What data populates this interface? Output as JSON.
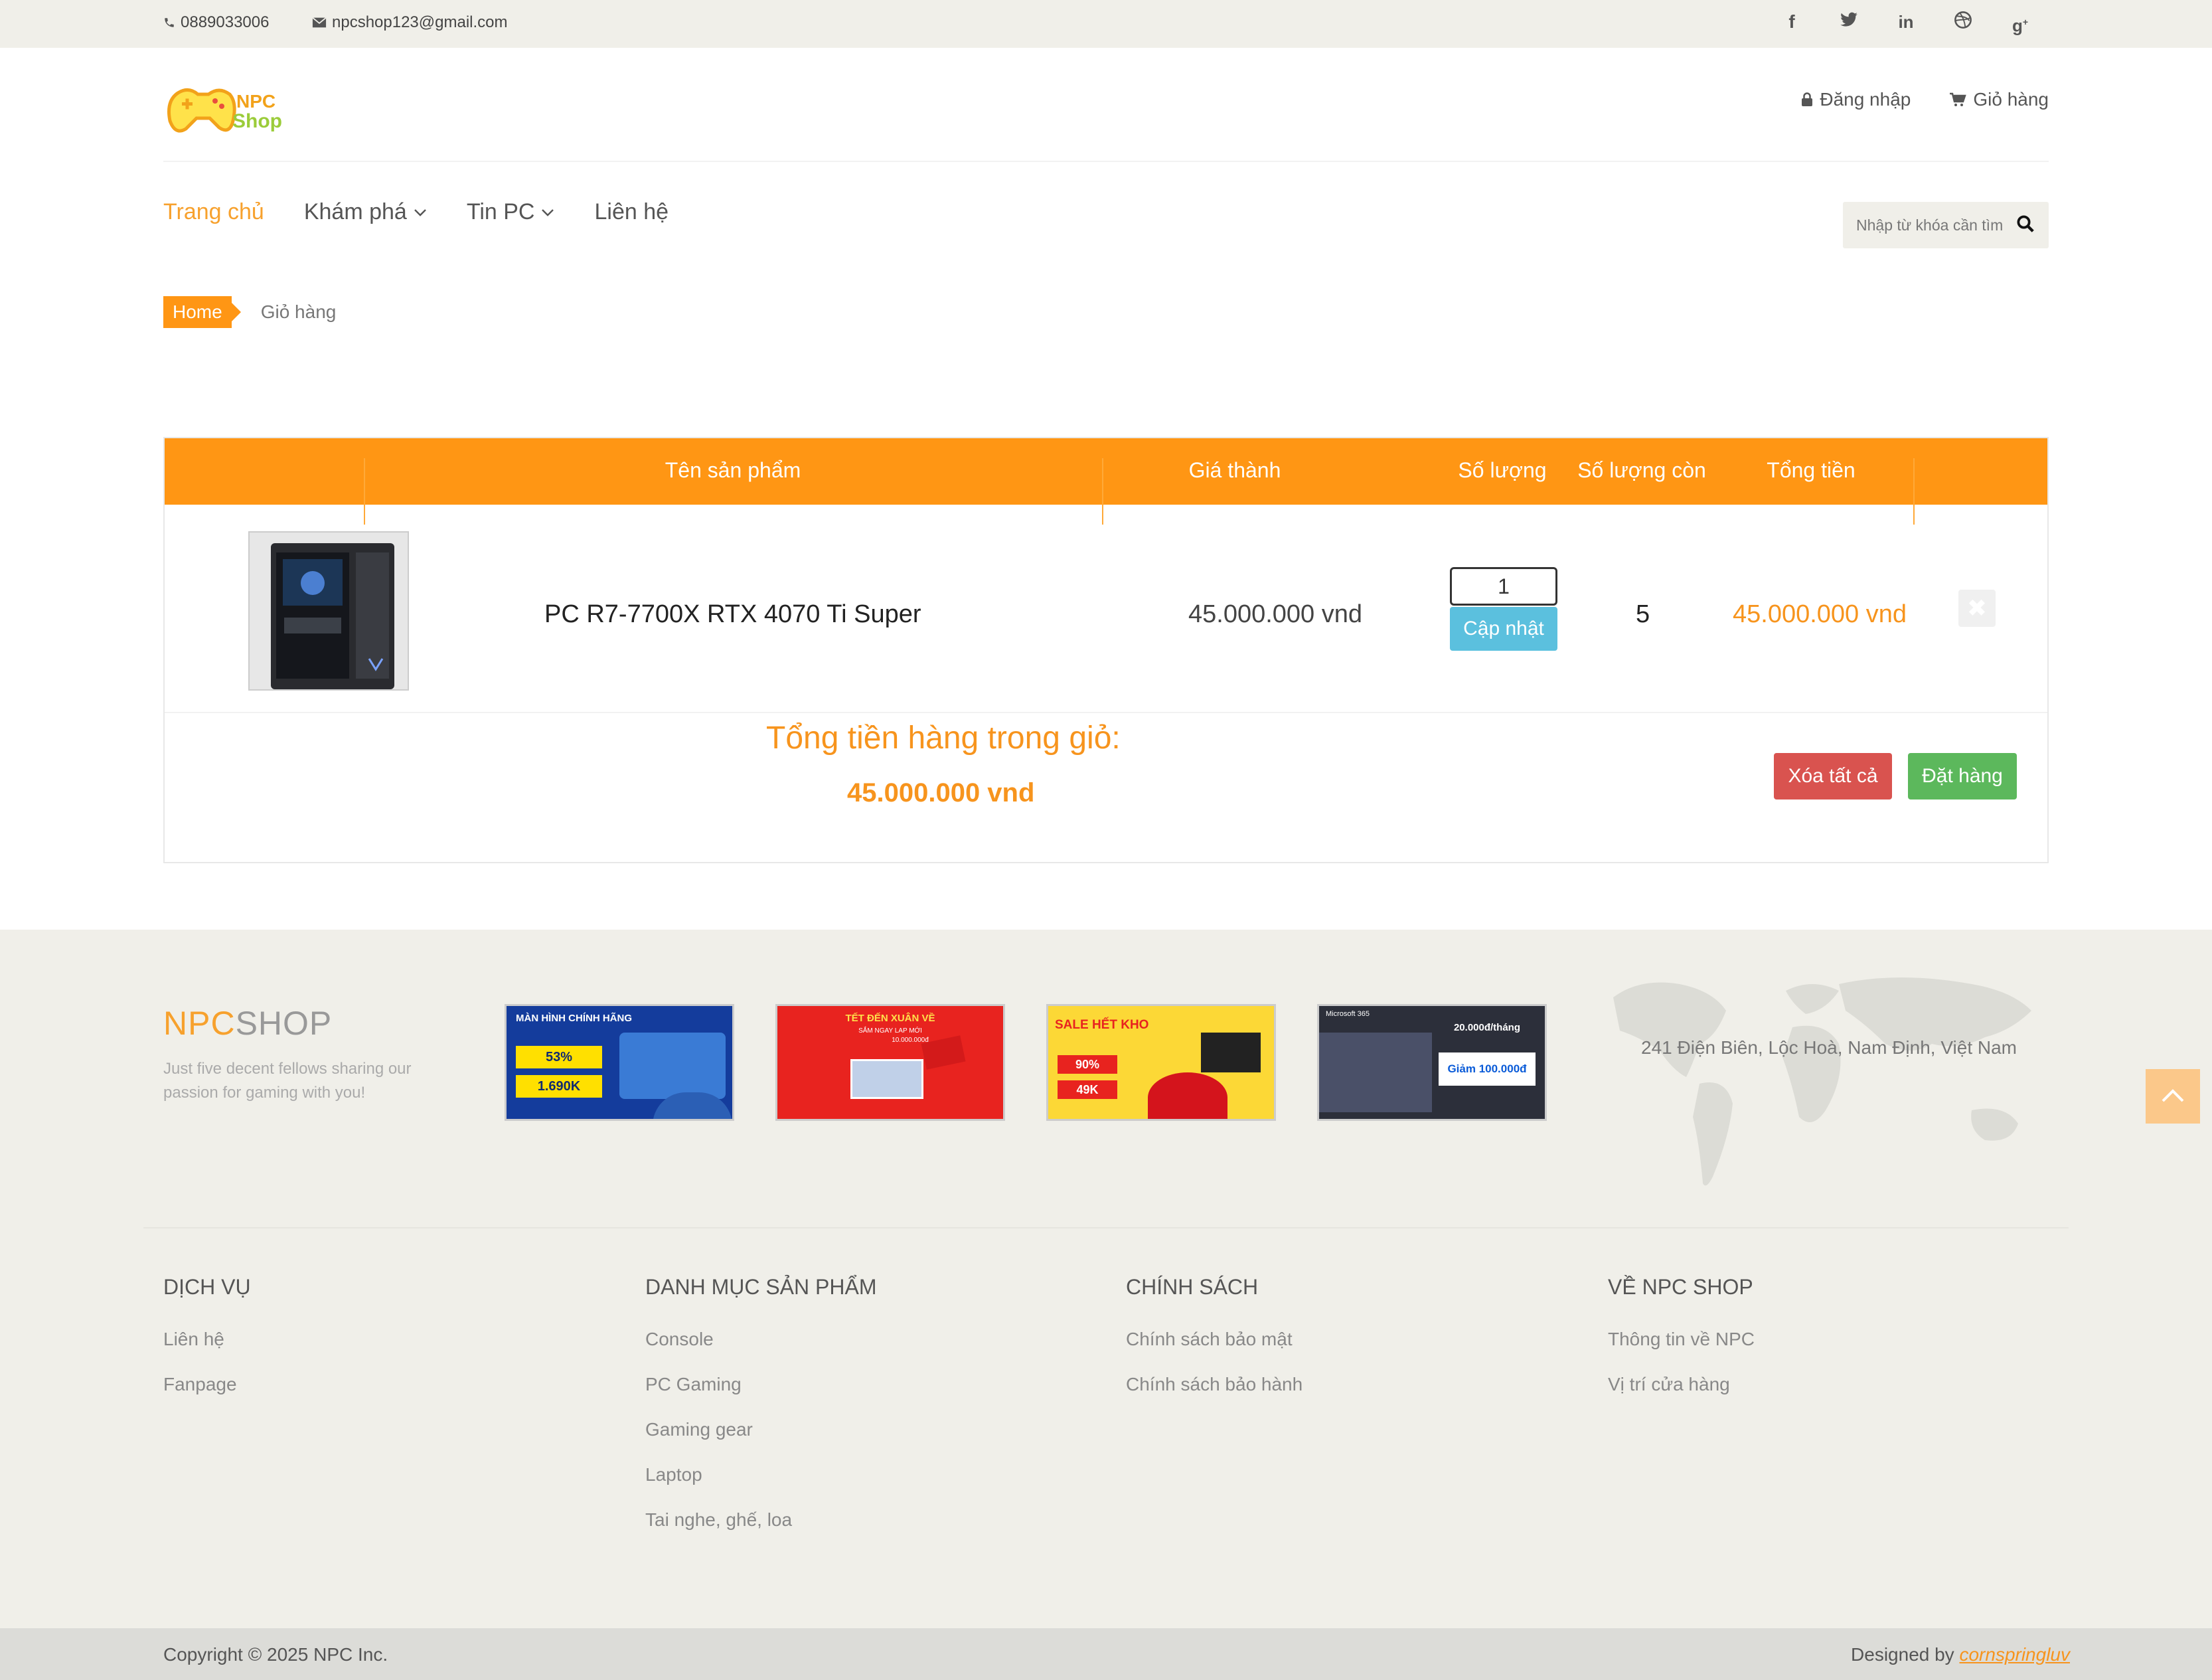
{
  "topbar": {
    "phone": "0889033006",
    "email": "npcshop123@gmail.com"
  },
  "social": [
    "facebook-icon",
    "twitter-icon",
    "linkedin-icon",
    "dribbble-icon",
    "google-plus-icon"
  ],
  "logo": {
    "line1": "NPC",
    "line2": "Shop"
  },
  "header": {
    "login": "Đăng nhập",
    "cart": "Giỏ hàng"
  },
  "nav": {
    "home": "Trang chủ",
    "explore": "Khám phá",
    "news": "Tin PC",
    "contact": "Liên hệ"
  },
  "search": {
    "placeholder": "Nhập từ khóa cần tìm"
  },
  "breadcrumb": {
    "home": "Home",
    "current": "Giỏ hàng"
  },
  "cart": {
    "columns": {
      "name": "Tên sản phẩm",
      "price": "Giá thành",
      "qty": "Số lượng",
      "stock": "Số lượng còn",
      "total": "Tổng tiền"
    },
    "items": [
      {
        "name": "PC R7-7700X RTX 4070 Ti Super",
        "price": "45.000.000 vnd",
        "qty": "1",
        "stock": "5",
        "total": "45.000.000 vnd"
      }
    ],
    "update_label": "Cập nhật",
    "total_label": "Tổng tiền hàng trong giỏ:",
    "total_value": "45.000.000 vnd",
    "clear_label": "Xóa tất cả",
    "order_label": "Đặt hàng"
  },
  "footer": {
    "brand_a": "NPC",
    "brand_b": "SHOP",
    "tagline": "Just five decent fellows sharing our passion for gaming with you!",
    "banners": [
      {
        "title": "MÀN HÌNH CHÍNH HÃNG",
        "line1": "53%",
        "line2": "1.690K"
      },
      {
        "title": "TẾT ĐẾN XUÂN VỀ",
        "line1": "SẮM NGAY LAP MỚI",
        "line2": "10.000.000đ"
      },
      {
        "title": "SALE HẾT KHO",
        "line1": "90%",
        "line2": "49K"
      },
      {
        "title": "Microsoft 365",
        "line1": "20.000đ/tháng",
        "line2": "Giảm 100.000đ"
      }
    ],
    "address": "241 Điện Biên, Lộc Hoà, Nam Định, Việt Nam",
    "columns": [
      {
        "title": "DỊCH VỤ",
        "items": [
          "Liên hệ",
          "Fanpage"
        ]
      },
      {
        "title": "DANH MỤC SẢN PHẨM",
        "items": [
          "Console",
          "PC Gaming",
          "Gaming gear",
          "Laptop",
          "Tai nghe, ghế, loa"
        ]
      },
      {
        "title": "CHÍNH SÁCH",
        "items": [
          "Chính sách bảo mật",
          "Chính sách bảo hành"
        ]
      },
      {
        "title": "VỀ NPC SHOP",
        "items": [
          "Thông tin về NPC",
          "Vị trí cửa hàng"
        ]
      }
    ],
    "copyright": "Copyright © 2025 NPC Inc.",
    "designed_by": "Designed by",
    "designer": "cornspringluv"
  },
  "colors": {
    "accent": "#ff9614",
    "update": "#5bc0de",
    "danger": "#d9534f",
    "success": "#5cb85c"
  }
}
